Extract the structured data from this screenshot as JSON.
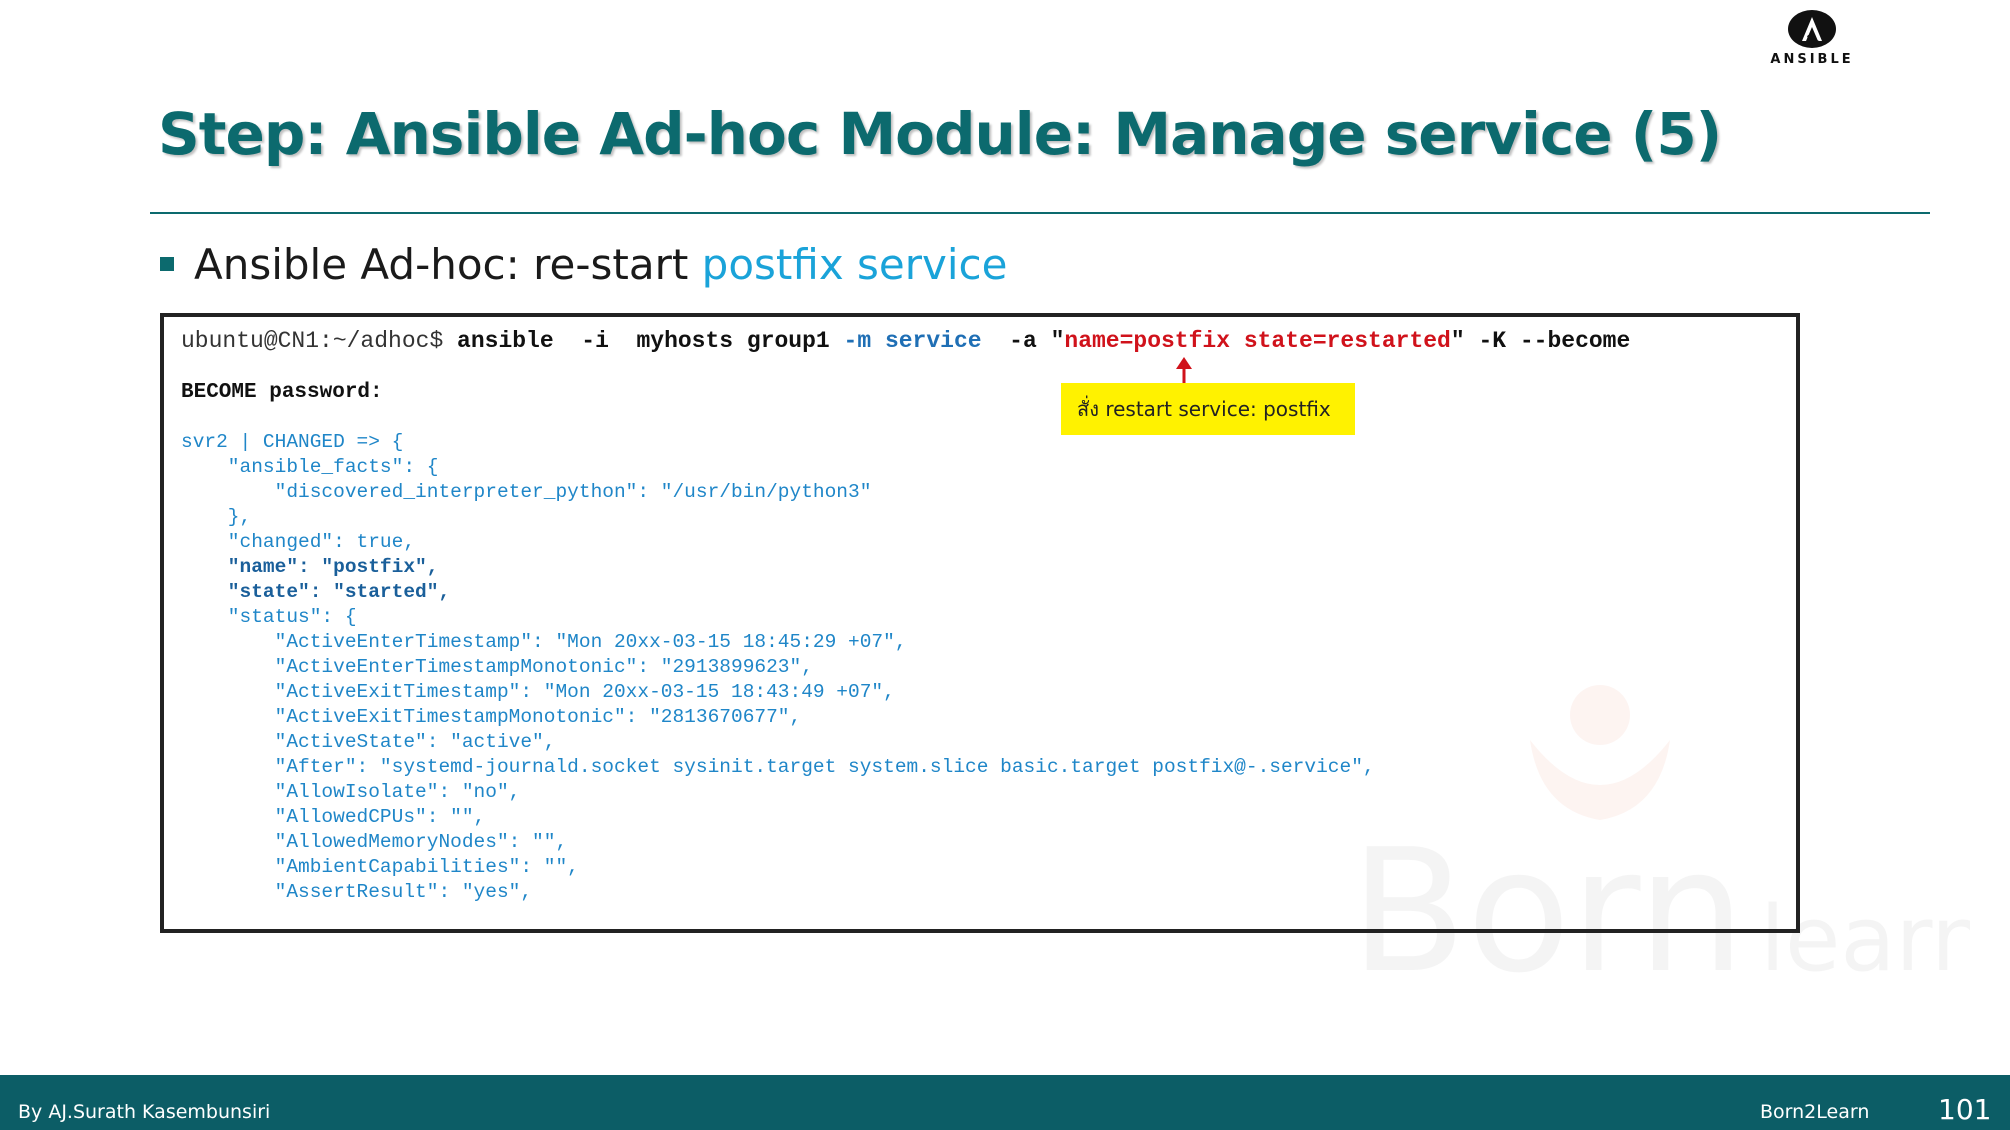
{
  "logo": {
    "text": "ANSIBLE",
    "icon": "ansible-a-icon"
  },
  "title": "Step: Ansible Ad-hoc Module: Manage service (5)",
  "bullet": {
    "text": "Ansible Ad-hoc: re-start ",
    "highlight": "postfix service"
  },
  "terminal": {
    "prompt": "ubuntu@CN1:~/adhoc$ ",
    "cmd_part1": "ansible  -i  myhosts group1 ",
    "cmd_flag_m": "-m ",
    "cmd_service": "service",
    "cmd_part2": "  -a \"",
    "cmd_args": "name=postfix state=restarted",
    "cmd_part3": "\" -K --become",
    "become_prompt": "BECOME password:",
    "output_line1": "svr2 | CHANGED => {",
    "output_line2": "    \"ansible_facts\": {",
    "output_line3": "        \"discovered_interpreter_python\": \"/usr/bin/python3\"",
    "output_line4": "    },",
    "output_line5": "    \"changed\": true,",
    "output_name": "    \"name\": \"postfix\",",
    "output_state": "    \"state\": \"started\",",
    "output_line8": "    \"status\": {",
    "status_lines": [
      "        \"ActiveEnterTimestamp\": \"Mon 20xx-03-15 18:45:29 +07\",",
      "        \"ActiveEnterTimestampMonotonic\": \"2913899623\",",
      "        \"ActiveExitTimestamp\": \"Mon 20xx-03-15 18:43:49 +07\",",
      "        \"ActiveExitTimestampMonotonic\": \"2813670677\",",
      "        \"ActiveState\": \"active\",",
      "        \"After\": \"systemd-journald.socket sysinit.target system.slice basic.target postfix@-.service\",",
      "        \"AllowIsolate\": \"no\",",
      "        \"AllowedCPUs\": \"\",",
      "        \"AllowedMemoryNodes\": \"\",",
      "        \"AmbientCapabilities\": \"\",",
      "        \"AssertResult\": \"yes\","
    ]
  },
  "callout": "สั่ง restart service: postfix",
  "watermark": {
    "text1": "Born",
    "text2": "learn"
  },
  "footer": {
    "author": "By AJ.Surath Kasembunsiri",
    "brand": "Born2Learn",
    "page": "101"
  },
  "colors": {
    "teal": "#0c6a6e",
    "footer": "#0c5d66",
    "accent_blue": "#1aa3d9",
    "code_blue": "#1f86c8",
    "red": "#d0121b",
    "callout": "#fff200"
  }
}
